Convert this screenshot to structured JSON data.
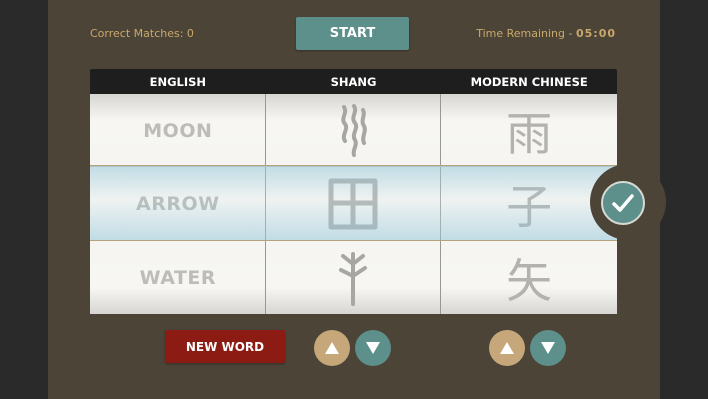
{
  "status": {
    "correct_label": "Correct Matches: ",
    "correct_count": "0",
    "time_label": "Time Remaining - ",
    "time_value": "05:00"
  },
  "controls": {
    "start_label": "START",
    "new_word_label": "NEW WORD"
  },
  "columns": {
    "headers": [
      "ENGLISH",
      "SHANG",
      "MODERN CHINESE"
    ]
  },
  "english": [
    "MOON",
    "ARROW",
    "WATER"
  ],
  "modern": [
    "雨",
    "子",
    "矢"
  ],
  "shang_icons": [
    "shang-rain-glyph-icon",
    "shang-field-glyph-icon",
    "shang-arrow-glyph-icon"
  ],
  "selected_row": 1,
  "icons": {
    "check": "check-icon",
    "up": "up-arrow-icon",
    "down": "down-arrow-icon"
  },
  "colors": {
    "panel": "#4d4438",
    "accent_teal": "#5d8f8b",
    "accent_tan": "#c5a77a",
    "danger": "#8b1b13",
    "status_text": "#c9a86b"
  }
}
